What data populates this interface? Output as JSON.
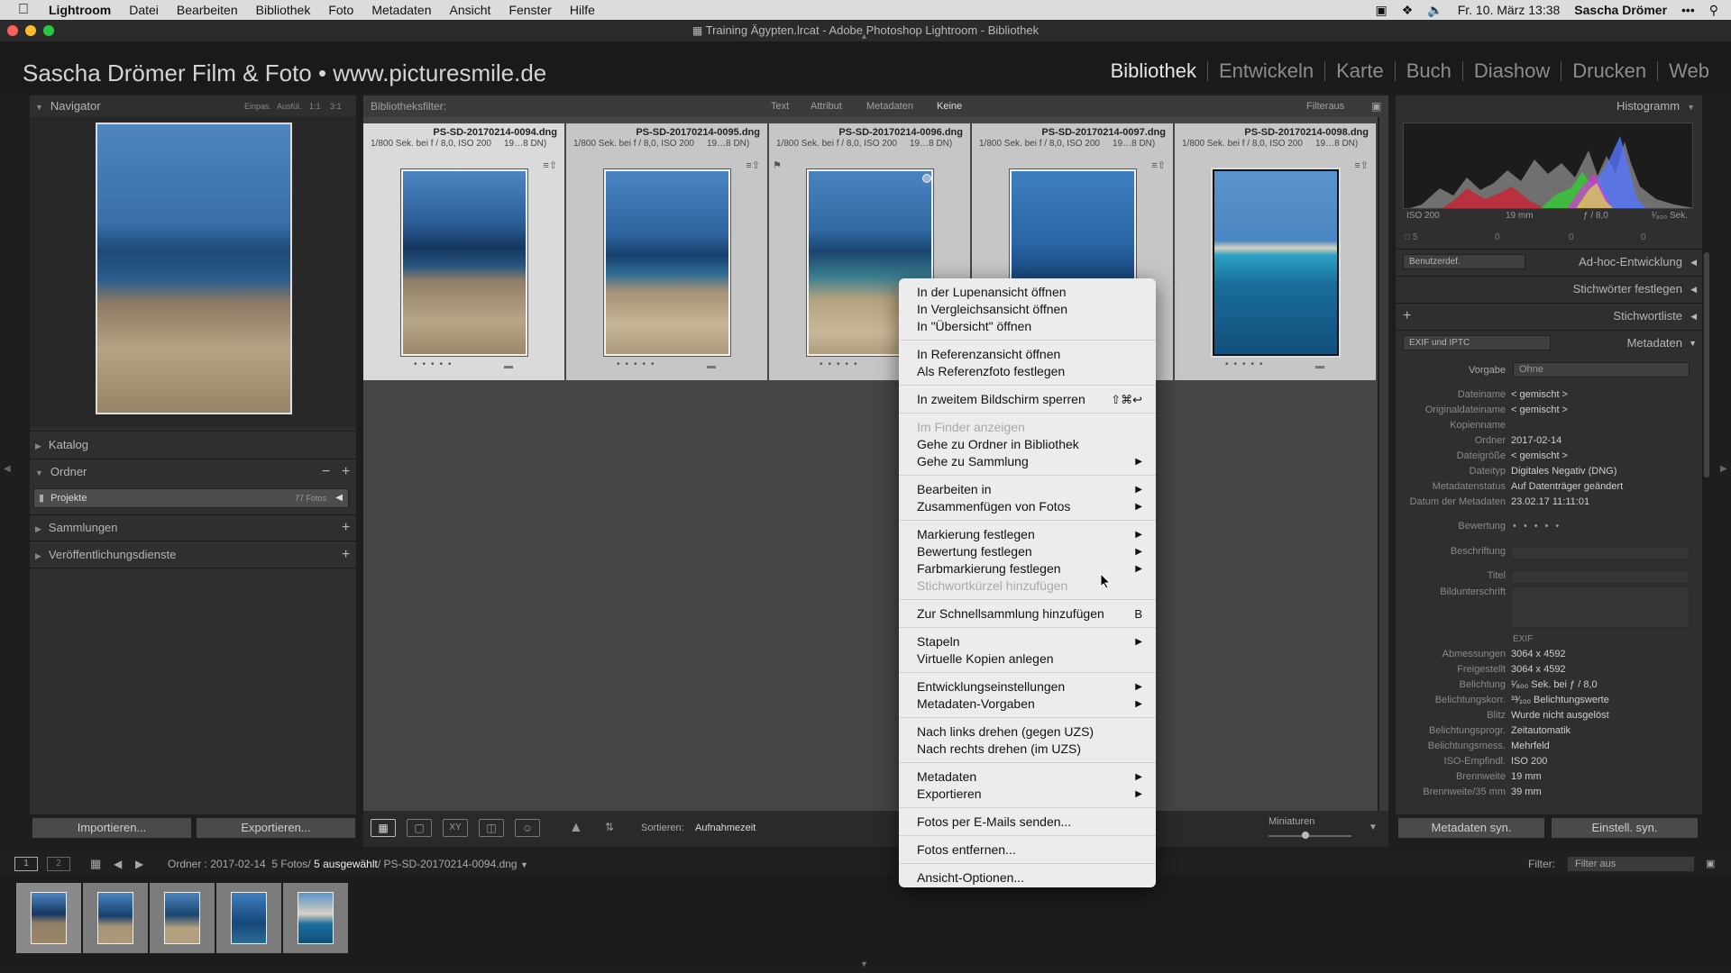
{
  "menubar": {
    "app": "Lightroom",
    "items": [
      "Datei",
      "Bearbeiten",
      "Bibliothek",
      "Foto",
      "Metadaten",
      "Ansicht",
      "Fenster",
      "Hilfe"
    ],
    "clock": "Fr. 10. März  13:38",
    "user": "Sascha Drömer"
  },
  "window": {
    "title": "Training Ägypten.lrcat - Adobe Photoshop Lightroom - Bibliothek"
  },
  "identity_plate": "Sascha Drömer Film & Foto • www.picturesmile.de",
  "modules": [
    "Bibliothek",
    "Entwickeln",
    "Karte",
    "Buch",
    "Diashow",
    "Drucken",
    "Web"
  ],
  "left_panel": {
    "navigator": {
      "title": "Navigator",
      "zoom_options": [
        "Einpas.",
        "Ausfül.",
        "1:1",
        "3:1"
      ]
    },
    "katalog": "Katalog",
    "ordner": "Ordner",
    "folder": {
      "name": "Projekte",
      "count": "77 Fotos"
    },
    "sammlungen": "Sammlungen",
    "dienste": "Veröffentlichungsdienste",
    "import_button": "Importieren...",
    "export_button": "Exportieren..."
  },
  "filter_bar": {
    "label": "Bibliotheksfilter:",
    "options": [
      "Text",
      "Attribut",
      "Metadaten",
      "Keine"
    ],
    "filter_status": "Filteraus"
  },
  "photos": [
    {
      "filename": "PS-SD-20170214-0094.dng",
      "exif_left": "1/800 Sek. bei f / 8,0, ISO 200",
      "exif_right": "19…8 DN)"
    },
    {
      "filename": "PS-SD-20170214-0095.dng",
      "exif_left": "1/800 Sek. bei f / 8,0, ISO 200",
      "exif_right": "19…8 DN)"
    },
    {
      "filename": "PS-SD-20170214-0096.dng",
      "exif_left": "1/800 Sek. bei f / 8,0, ISO 200",
      "exif_right": "19…8 DN)"
    },
    {
      "filename": "PS-SD-20170214-0097.dng",
      "exif_left": "1/800 Sek. bei f / 8,0, ISO 200",
      "exif_right": "19…8 DN)"
    },
    {
      "filename": "PS-SD-20170214-0098.dng",
      "exif_left": "1/800 Sek. bei f / 8,0, ISO 200",
      "exif_right": "19…8 DN)"
    }
  ],
  "toolbar": {
    "sort_label": "Sortieren:",
    "sort_value": "Aufnahmezeit",
    "thumb_label": "Miniaturen",
    "thumb_size": 0.45
  },
  "filmstrip_bar": {
    "screen1": "1",
    "screen2": "2",
    "folder_prefix": "Ordner : 2017-02-14",
    "count": "5 Fotos/",
    "selected": "5 ausgewählt",
    "file": "/ PS-SD-20170214-0094.dng",
    "filter_label": "Filter:",
    "filter_value": "Filter aus"
  },
  "right_panel": {
    "histogram": {
      "title": "Histogramm",
      "iso": "ISO 200",
      "focal": "19 mm",
      "aperture": "ƒ / 8,0",
      "shutter": "¹⁄₈₀₀ Sek.",
      "count": "5",
      "zeros": [
        "0",
        "0",
        "0"
      ]
    },
    "quick_develop": {
      "preset": "Benutzerdef.",
      "title": "Ad-hoc-Entwicklung"
    },
    "keywording": "Stichwörter festlegen",
    "keyword_list": "Stichwortliste",
    "metadata": {
      "set": "EXIF und IPTC",
      "title": "Metadaten",
      "preset_label": "Vorgabe",
      "preset_value": "Ohne",
      "rows": [
        {
          "k": "Dateiname",
          "v": "< gemischt >"
        },
        {
          "k": "Originaldateiname",
          "v": "< gemischt >"
        },
        {
          "k": "Kopienname",
          "v": ""
        },
        {
          "k": "Ordner",
          "v": "2017-02-14"
        },
        {
          "k": "Dateigröße",
          "v": "< gemischt >"
        },
        {
          "k": "Dateityp",
          "v": "Digitales Negativ (DNG)"
        },
        {
          "k": "Metadatenstatus",
          "v": "Auf Datenträger geändert"
        },
        {
          "k": "Datum der Metadaten",
          "v": "23.02.17 11:11:01"
        }
      ],
      "rating_label": "Bewertung",
      "caption_label": "Beschriftung",
      "title_label": "Titel",
      "subtitle_label": "Bildunterschrift",
      "exif_header": "EXIF",
      "exif_rows": [
        {
          "k": "Abmessungen",
          "v": "3064 x 4592"
        },
        {
          "k": "Freigestellt",
          "v": "3064 x 4592"
        },
        {
          "k": "Belichtung",
          "v": "¹⁄₈₀₀ Sek. bei ƒ / 8,0"
        },
        {
          "k": "Belichtungskorr.",
          "v": "³³⁄₁₀₀ Belichtungswerte"
        },
        {
          "k": "Blitz",
          "v": "Wurde nicht ausgelöst"
        },
        {
          "k": "Belichtungsprogr.",
          "v": "Zeitautomatik"
        },
        {
          "k": "Belichtungsmess.",
          "v": "Mehrfeld"
        },
        {
          "k": "ISO-Empfindl.",
          "v": "ISO 200"
        },
        {
          "k": "Brennweite",
          "v": "19 mm"
        },
        {
          "k": "Brennweite/35 mm",
          "v": "39 mm"
        }
      ]
    },
    "sync_metadata": "Metadaten syn.",
    "sync_settings": "Einstell. syn."
  },
  "context_menu": {
    "groups": [
      [
        {
          "label": "In der Lupenansicht öffnen"
        },
        {
          "label": "In Vergleichsansicht öffnen"
        },
        {
          "label": "In \"Übersicht\" öffnen"
        }
      ],
      [
        {
          "label": "In Referenzansicht öffnen"
        },
        {
          "label": "Als Referenzfoto festlegen"
        }
      ],
      [
        {
          "label": "In zweitem Bildschirm sperren",
          "shortcut": "⇧⌘↩"
        }
      ],
      [
        {
          "label": "Im Finder anzeigen",
          "disabled": true
        },
        {
          "label": "Gehe zu Ordner in Bibliothek"
        },
        {
          "label": "Gehe zu Sammlung",
          "submenu": true
        }
      ],
      [
        {
          "label": "Bearbeiten in",
          "submenu": true
        },
        {
          "label": "Zusammenfügen von Fotos",
          "submenu": true
        }
      ],
      [
        {
          "label": "Markierung festlegen",
          "submenu": true
        },
        {
          "label": "Bewertung festlegen",
          "submenu": true
        },
        {
          "label": "Farbmarkierung festlegen",
          "submenu": true
        },
        {
          "label": "Stichwortkürzel hinzufügen",
          "disabled": true
        }
      ],
      [
        {
          "label": "Zur Schnellsammlung hinzufügen",
          "shortcut": "B"
        }
      ],
      [
        {
          "label": "Stapeln",
          "submenu": true
        },
        {
          "label": "Virtuelle Kopien anlegen"
        }
      ],
      [
        {
          "label": "Entwicklungseinstellungen",
          "submenu": true
        },
        {
          "label": "Metadaten-Vorgaben",
          "submenu": true
        }
      ],
      [
        {
          "label": "Nach links drehen (gegen UZS)"
        },
        {
          "label": "Nach rechts drehen (im UZS)"
        }
      ],
      [
        {
          "label": "Metadaten",
          "submenu": true
        },
        {
          "label": "Exportieren",
          "submenu": true
        }
      ],
      [
        {
          "label": "Fotos per E-Mails senden..."
        }
      ],
      [
        {
          "label": "Fotos entfernen..."
        }
      ],
      [
        {
          "label": "Ansicht-Optionen..."
        }
      ]
    ]
  },
  "colors": {
    "panel": "#2f2f2f",
    "grid": "#454545",
    "cell": "#c6c6c6",
    "menu": "#ececec"
  }
}
